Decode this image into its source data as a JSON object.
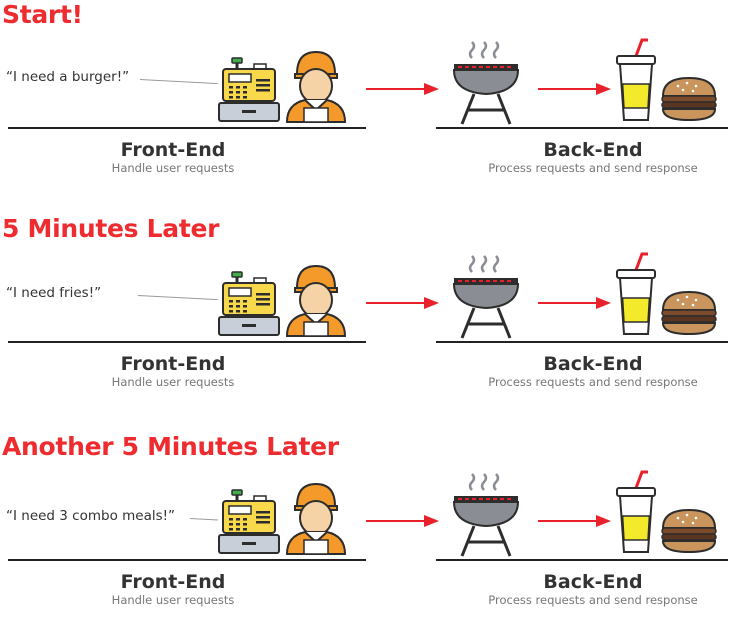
{
  "colors": {
    "title_red": "#ee2b2f",
    "arrow_red": "#e8212a",
    "register_yellow": "#f7d94b",
    "register_gray": "#c9cfd8",
    "register_green": "#3fae49",
    "cap_orange": "#f39a2b",
    "skin": "#f5d3a6",
    "grill_gray": "#8a8d93",
    "cup_yellow": "#f3ea2c",
    "burger_brown": "#7a4a2a",
    "outline": "#2d2d2d"
  },
  "panels": [
    {
      "title": "Start!",
      "quote": "“I need a burger!”",
      "front_title": "Front-End",
      "front_subtitle": "Handle user requests",
      "back_title": "Back-End",
      "back_subtitle": "Process requests and send response"
    },
    {
      "title": "5 Minutes Later",
      "quote": "“I need fries!”",
      "front_title": "Front-End",
      "front_subtitle": "Handle user requests",
      "back_title": "Back-End",
      "back_subtitle": "Process requests and send response"
    },
    {
      "title": "Another 5 Minutes Later",
      "quote": "“I need 3 combo meals!”",
      "front_title": "Front-End",
      "front_subtitle": "Handle user requests",
      "back_title": "Back-End",
      "back_subtitle": "Process requests and send response"
    }
  ],
  "icons": [
    "cash-register-icon",
    "cashier-icon",
    "grill-icon",
    "drink-cup-icon",
    "burger-icon",
    "arrow-icon"
  ]
}
